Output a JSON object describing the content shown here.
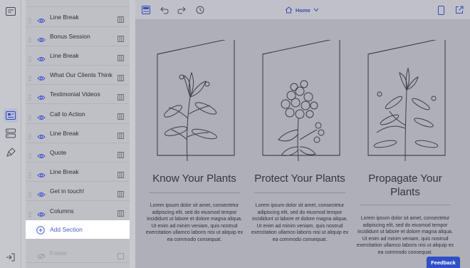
{
  "sections": [
    {
      "label": "Line Break",
      "hidden": false
    },
    {
      "label": "Bonus Session",
      "hidden": false
    },
    {
      "label": "Line Break",
      "hidden": false
    },
    {
      "label": "What Our Clients Think",
      "hidden": false
    },
    {
      "label": "Testimonial Videos",
      "hidden": false
    },
    {
      "label": "Call to Action",
      "hidden": false
    },
    {
      "label": "Line Break",
      "hidden": false
    },
    {
      "label": "Quote",
      "hidden": false
    },
    {
      "label": "Line Break",
      "hidden": false
    },
    {
      "label": "Get in touch!",
      "hidden": false
    },
    {
      "label": "Columns",
      "hidden": false
    }
  ],
  "add_section_label": "Add Section",
  "footer_label": "Footer",
  "toolbar": {
    "page_name": "Home"
  },
  "content": {
    "columns": [
      {
        "heading": "Know Your Plants",
        "body": "Lorem ipsum dolor sit amet, consectetur adipiscing elit, sed do eiusmod tempor incididunt ut labore et dolore magna aliqua. Ut enim ad minim veniam, quis nostrud exercitation ullamco laboris nisi ut aliquip ex ea commodo consequat."
      },
      {
        "heading": "Protect Your Plants",
        "body": "Lorem ipsum dolor sit amet, consectetur adipiscing elit, sed do eiusmod tempor incididunt ut labore et dolore magna aliqua. Ut enim ad minim veniam, quis nostrud exercitation ullamco laboris nisi ut aliquip ex ea commodo consequat."
      },
      {
        "heading": "Propagate Your Plants",
        "body": "Lorem ipsum dolor sit amet, consectetur adipiscing elit, sed do eiusmod tempor incididunt ut labore et dolore magna aliqua. Ut enim ad minim veniam, quis nostrud exercitation ullamco laboris nisi ut aliquip ex ea commodo consequat."
      }
    ]
  },
  "feedback_label": "Feedback",
  "icons": {
    "rail": [
      "pages-icon",
      "sections-icon",
      "layers-icon",
      "brush-icon",
      "exit-icon"
    ],
    "toolbar": [
      "save-icon",
      "undo-icon",
      "redo-icon",
      "history-icon",
      "home-icon",
      "chevron-down-icon",
      "mobile-preview-icon",
      "external-link-icon"
    ]
  },
  "colors": {
    "accent": "#2f4fc7",
    "link": "#4a5bd4"
  }
}
